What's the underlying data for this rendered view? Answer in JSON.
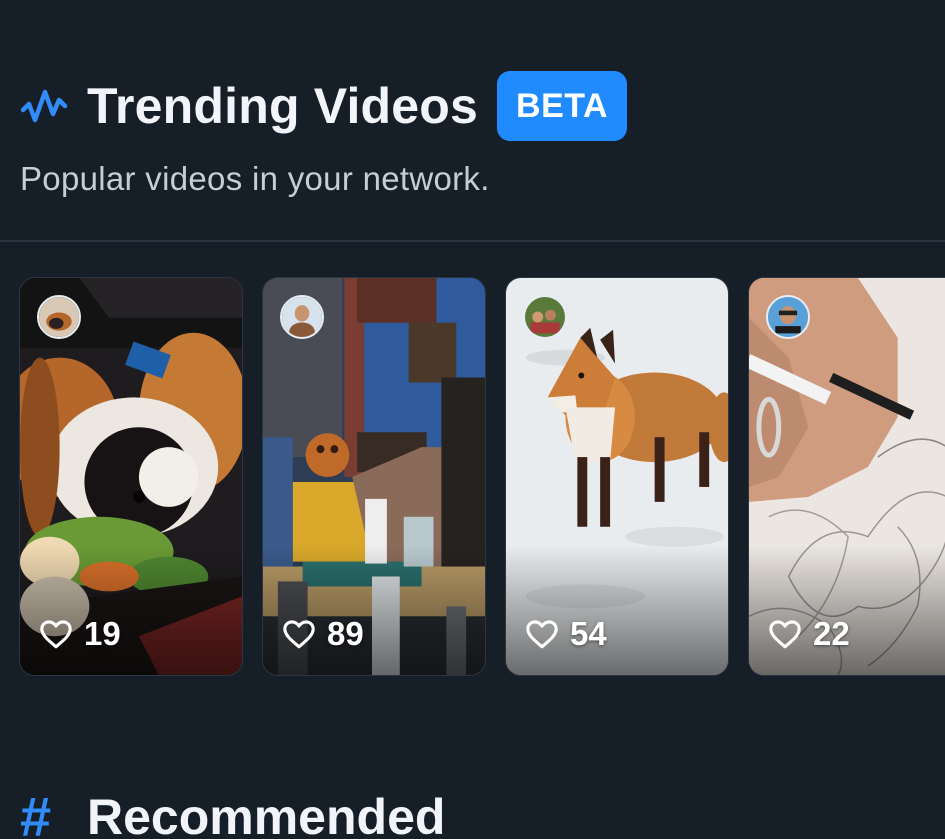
{
  "trending": {
    "icon": "activity-wave-icon",
    "title": "Trending Videos",
    "badge": "BETA",
    "subtitle": "Popular videos in your network."
  },
  "videos": [
    {
      "subject": "guinea pig eating vegetables",
      "likes": "19",
      "avatar": "avatar-guinea-pig"
    },
    {
      "subject": "people at a table with drinks",
      "likes": "89",
      "avatar": "avatar-woman"
    },
    {
      "subject": "red fox in snow",
      "likes": "54",
      "avatar": "avatar-group"
    },
    {
      "subject": "hand drawing a superhero sketch",
      "likes": "22",
      "avatar": "avatar-alliance-guitar"
    }
  ],
  "recommended": {
    "icon": "hash-icon",
    "title": "Recommended"
  },
  "colors": {
    "background": "#161e28",
    "accent": "#1f8bff",
    "divider": "#2b3541"
  }
}
